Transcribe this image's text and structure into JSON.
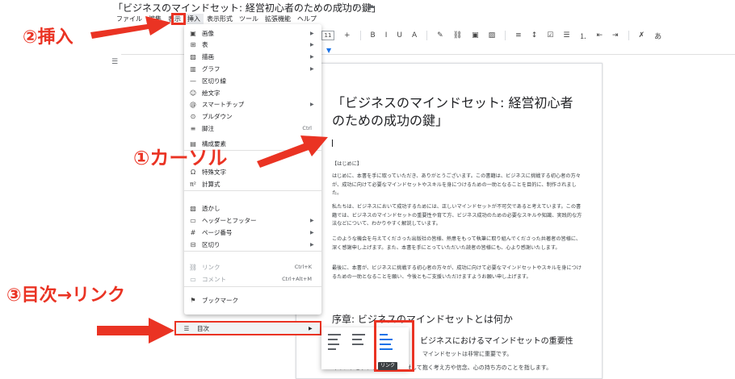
{
  "app": {
    "doc_title": "「ビジネスのマインドセット: 経営初心者のための成功の鍵」",
    "menubar": [
      {
        "label": "ファイル"
      },
      {
        "label": "編集"
      },
      {
        "label": "表示"
      },
      {
        "label": "挿入",
        "active": true
      },
      {
        "label": "表示形式"
      },
      {
        "label": "ツール"
      },
      {
        "label": "拡張機能"
      },
      {
        "label": "ヘルプ"
      }
    ]
  },
  "toolbar": {
    "font_size": "11",
    "icons": [
      "plus-icon",
      "bold-icon",
      "italic-icon",
      "underline-icon",
      "text-color-icon",
      "highlight-icon",
      "link-icon",
      "comment-icon",
      "image-icon",
      "align-icon",
      "line-spacing-icon",
      "checklist-icon",
      "bullet-list-icon",
      "numbered-list-icon",
      "indent-decrease-icon",
      "indent-increase-icon",
      "clear-format-icon",
      "input-tools-icon"
    ],
    "glyphs": [
      "+",
      "B",
      "I",
      "U",
      "A",
      "✎",
      "⛓",
      "▣",
      "▨",
      "≡",
      "↕",
      "☑",
      "☰",
      "⒈",
      "⇤",
      "⇥",
      "✗",
      "あ"
    ]
  },
  "insert_menu": {
    "items": [
      {
        "icon": "image-icon",
        "glyph": "▣",
        "label": "画像",
        "arrow": true
      },
      {
        "icon": "table-icon",
        "glyph": "⊞",
        "label": "表",
        "arrow": true
      },
      {
        "icon": "drawing-icon",
        "glyph": "▨",
        "label": "描画",
        "arrow": true
      },
      {
        "icon": "chart-icon",
        "glyph": "▥",
        "label": "グラフ",
        "arrow": true
      },
      {
        "icon": "horizontal-line-icon",
        "glyph": "—",
        "label": "区切り線",
        "arrow": false
      },
      {
        "icon": "emoji-icon",
        "glyph": "☺",
        "label": "絵文字",
        "arrow": false
      },
      {
        "icon": "smart-chip-icon",
        "glyph": "@",
        "label": "スマートチップ",
        "arrow": true
      },
      {
        "icon": "dropdown-icon",
        "glyph": "⊙",
        "label": "プルダウン",
        "arrow": false
      },
      {
        "icon": "footnote-icon",
        "glyph": "≡",
        "label": "脚注",
        "shortcut": "Ctrl",
        "arrow": false
      },
      {
        "icon": "building-blocks-icon",
        "glyph": "▤",
        "label": "構成要素",
        "arrow": true
      },
      {
        "icon": "special-characters-icon",
        "glyph": "Ω",
        "label": "特殊文字",
        "arrow": false
      },
      {
        "icon": "equation-icon",
        "glyph": "π²",
        "label": "計算式",
        "arrow": false
      },
      {
        "icon": "watermark-icon",
        "glyph": "▧",
        "label": "透かし",
        "arrow": false
      },
      {
        "icon": "header-footer-icon",
        "glyph": "▭",
        "label": "ヘッダーとフッター",
        "arrow": true
      },
      {
        "icon": "page-number-icon",
        "glyph": "#",
        "label": "ページ番号",
        "arrow": true
      },
      {
        "icon": "break-icon",
        "glyph": "⊟",
        "label": "区切り",
        "arrow": true
      },
      {
        "icon": "link-icon",
        "glyph": "⛓",
        "label": "リンク",
        "shortcut": "Ctrl+K",
        "arrow": false,
        "disabled": true
      },
      {
        "icon": "comment-icon",
        "glyph": "▭",
        "label": "コメント",
        "shortcut": "Ctrl+Alt+M",
        "arrow": false,
        "disabled": true
      },
      {
        "icon": "bookmark-icon",
        "glyph": "⚑",
        "label": "ブックマーク",
        "arrow": false
      }
    ],
    "toc": {
      "icon": "toc-icon",
      "glyph": "☰",
      "label": "目次"
    }
  },
  "toc_submenu": {
    "tooltip": "リンク"
  },
  "document": {
    "title": "「ビジネスのマインドセット: 経営初心者のための成功の鍵」",
    "section_label": "【はじめに】",
    "paragraphs": [
      "はじめに、本書を手に取っていただき、ありがとうございます。この書籍は、ビジネスに挑戦する初心者の方々が、成功に向けて必要なマインドセットやスキルを身につけるための一助となることを目的に、制作されました。",
      "私たちは、ビジネスにおいて成功するためには、正しいマインドセットが不可欠であると考えています。この書籍では、ビジネスのマインドセットの重要性や育て方、ビジネス成功のための必要なスキルや知識、実践的な方法などについて、わかりやすく解説しています。",
      "このような機会を与えてくださった出版社の皆様、熱意をもって執筆に取り組んでくださった共著者の皆様に、深く感謝申し上げます。また、本書を手にとっていただいた読者の皆様にも、心より感謝いたします。",
      "最後に、本書が、ビジネスに挑戦する初心者の方々が、成功に向けて必要なマインドセットやスキルを身につけるための一助となることを願い、今後ともご支援いただけますようお願い申し上げます。"
    ],
    "heading2": "序章: ビジネスのマインドセットとは何か",
    "heading3": "ビジネスにおけるマインドセットの重要性",
    "subline": "マインドセットは非常に重要です。",
    "bottomline": "マインドセットとは、物事に対して抱く考え方や信念、心の持ち方のことを指します。"
  },
  "annotations": {
    "insert": "②挿入",
    "cursor": "①カーソル",
    "toc_link": "③目次→リンク"
  },
  "colors": {
    "annotation_red": "#ea3323",
    "accent_blue": "#1a73e8"
  }
}
